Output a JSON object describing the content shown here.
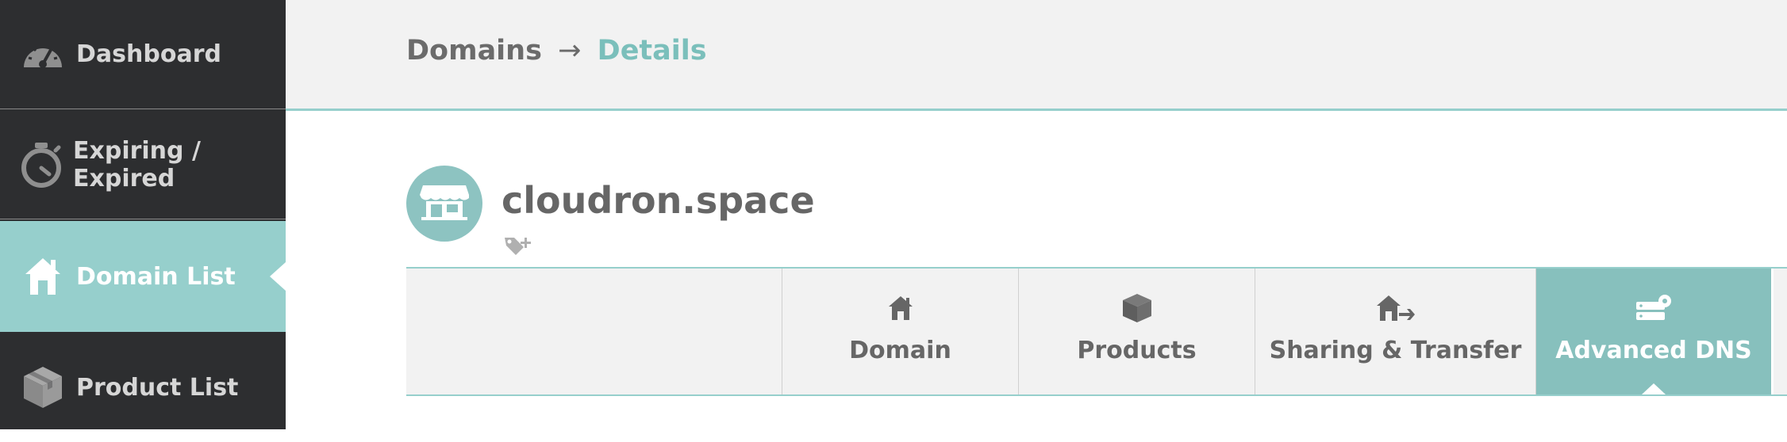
{
  "sidebar": {
    "items": [
      {
        "label": "Dashboard",
        "icon": "speedometer-icon"
      },
      {
        "label": "Expiring / Expired",
        "icon": "stopwatch-icon"
      },
      {
        "label": "Domain List",
        "icon": "home-icon",
        "active": true
      },
      {
        "label": "Product List",
        "icon": "box-icon"
      }
    ]
  },
  "header": {
    "breadcrumb": {
      "parent": "Domains",
      "separator": "→",
      "current": "Details"
    }
  },
  "domain": {
    "name": "cloudron.space",
    "avatar_icon": "storefront-icon",
    "tag_icon": "tag-add-icon"
  },
  "tabs": [
    {
      "label": "Domain",
      "icon": "home-icon"
    },
    {
      "label": "Products",
      "icon": "box-icon"
    },
    {
      "label": "Sharing & Transfer",
      "icon": "home-share-icon"
    },
    {
      "label": "Advanced DNS",
      "icon": "server-settings-icon",
      "active": true
    }
  ],
  "colors": {
    "accent": "#96cfcc",
    "sidebar_bg": "#2d2e30",
    "text": "#666666"
  }
}
